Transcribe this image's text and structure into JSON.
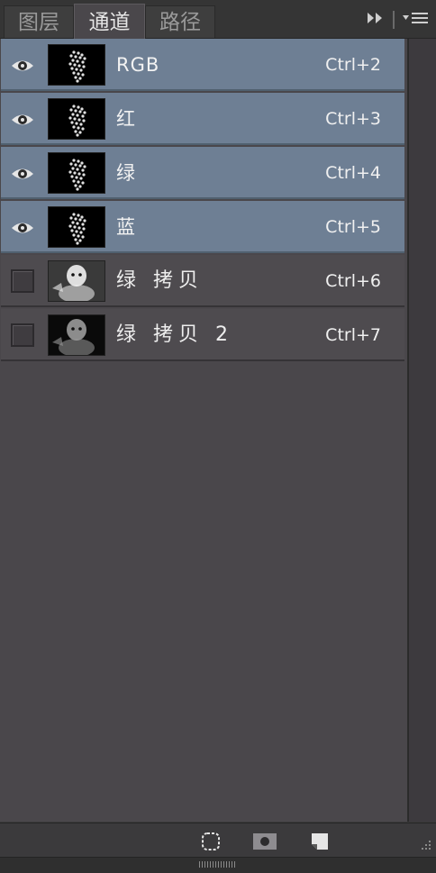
{
  "tabs": [
    {
      "label": "图层",
      "active": false
    },
    {
      "label": "通道",
      "active": true
    },
    {
      "label": "路径",
      "active": false
    }
  ],
  "toolbar": {
    "collapse_icon": "double-chevron-right-icon",
    "menu_icon": "panel-menu-icon"
  },
  "channels": [
    {
      "name": "RGB",
      "shortcut": "Ctrl+2",
      "visible": true,
      "selected": true,
      "thumb": "dark-face"
    },
    {
      "name": "红",
      "shortcut": "Ctrl+3",
      "visible": true,
      "selected": true,
      "thumb": "dark-face"
    },
    {
      "name": "绿",
      "shortcut": "Ctrl+4",
      "visible": true,
      "selected": true,
      "thumb": "dark-face"
    },
    {
      "name": "蓝",
      "shortcut": "Ctrl+5",
      "visible": true,
      "selected": true,
      "thumb": "dark-face"
    },
    {
      "name": "绿 拷贝",
      "shortcut": "Ctrl+6",
      "visible": false,
      "selected": false,
      "thumb": "light-face"
    },
    {
      "name": "绿 拷贝 2",
      "shortcut": "Ctrl+7",
      "visible": false,
      "selected": false,
      "thumb": "mid-face"
    }
  ],
  "footer": {
    "icons": [
      "selection-from-channel-icon",
      "save-selection-icon",
      "new-channel-icon"
    ]
  },
  "colors": {
    "selected_row": "#6e7f94",
    "panel_bg": "#4a474b"
  }
}
